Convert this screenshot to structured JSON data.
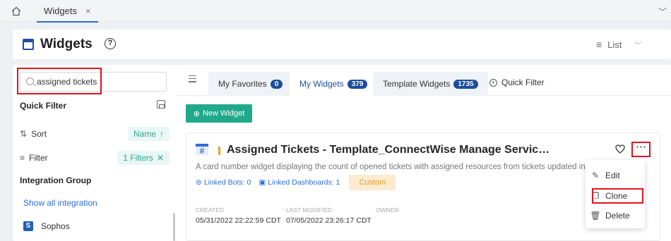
{
  "tabbar": {
    "tab_label": "Widgets",
    "tab_close": "×",
    "chevron": "﹀"
  },
  "header": {
    "title": "Widgets",
    "help": "?",
    "view_mode": "List"
  },
  "search": {
    "value": "assigned tickets"
  },
  "left_panel": {
    "quick_filter_label": "Quick Filter",
    "sort_label": "Sort",
    "sort_value": "Name",
    "filter_label": "Filter",
    "filter_value": "1 Filters",
    "integration_group_label": "Integration Group",
    "show_all_link": "Show all integration",
    "integrations": [
      {
        "label": "Sophos",
        "icon_letter": "S"
      }
    ]
  },
  "filter_tabs": [
    {
      "label": "My Favorites",
      "count": "0"
    },
    {
      "label": "My Widgets",
      "count": "379"
    },
    {
      "label": "Template Widgets",
      "count": "1735"
    }
  ],
  "quick_filter_button": "Quick Filter",
  "new_widget_label": "New Widget",
  "card": {
    "title": "Assigned Tickets - Template_ConnectWise Manage Servic…",
    "description": "A card number widget displaying the count of opened tickets with assigned resources from tickets updated in",
    "linked_bots": "Linked Bots: 0",
    "linked_dashboards": "Linked Dashboards: 1",
    "tag": "Custom",
    "created_label": "CREATED",
    "created_value": "05/31/2022 22:22:59 CDT",
    "modified_label": "LAST MODIFIED",
    "modified_value": "07/05/2022 23:26:17 CDT",
    "owner_label": "OWNER"
  },
  "dropdown": {
    "items": [
      {
        "label": "Edit"
      },
      {
        "label": "Clone"
      },
      {
        "label": "Delete"
      }
    ]
  },
  "colors": {
    "accent": "#1f4e9c",
    "primary_button": "#20a98a",
    "highlight": "#e1131f",
    "tag_bg": "#fdebcf"
  }
}
